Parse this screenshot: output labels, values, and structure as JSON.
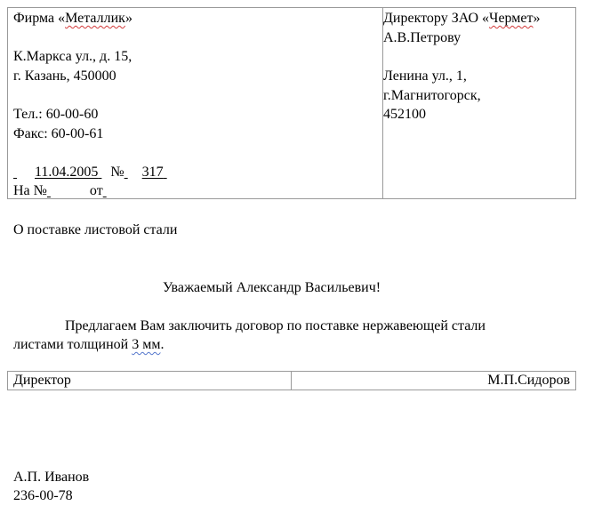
{
  "sender": {
    "company_prefix": "Фирма «",
    "company_name": "Металлик",
    "company_suffix": "»",
    "street": "К.Маркса ул., д. 15,",
    "city": "г. Казань, 450000",
    "phone": "Тел.: 60-00-60",
    "fax": "Факс: 60-00-61",
    "date_line_pre": "      ",
    "date": "11.04.2005",
    "number_label": "№",
    "number": "317",
    "ref_label": "На №",
    "ref_from_label": "от"
  },
  "recipient": {
    "title_prefix": "Директору ЗАО «",
    "title_company": "Чермет",
    "title_suffix": "»",
    "name": "А.В.Петрову",
    "street": "Ленина ул., 1,",
    "city": "г.Магнитогорск,",
    "zip": "452100"
  },
  "subject": "О поставке листовой стали",
  "greeting": "Уважаемый Александр Васильевич!",
  "body": {
    "line1": "Предлагаем Вам заключить договор по поставке нержавеющей стали",
    "line2_pre": "листами толщиной ",
    "line2_mark": "3 мм",
    "line2_post": "."
  },
  "signature": {
    "position": "Директор",
    "name": "М.П.Сидоров"
  },
  "executor": {
    "name": "А.П. Иванов",
    "phone": "236-00-78"
  }
}
